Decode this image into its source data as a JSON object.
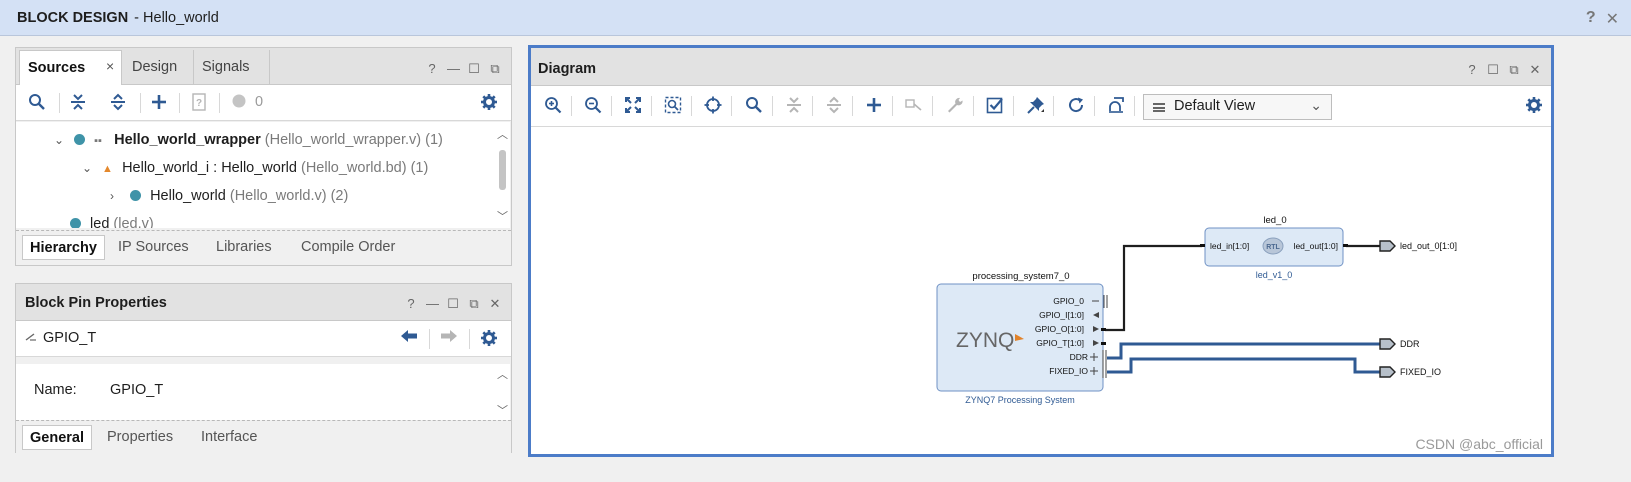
{
  "window": {
    "title_bold": "BLOCK DESIGN",
    "title_rest": "- Hello_world",
    "help": "?",
    "close": "✕"
  },
  "sources": {
    "tabs": [
      {
        "label": "Sources"
      },
      {
        "label": "Design"
      },
      {
        "label": "Signals"
      }
    ],
    "close_glyph": "×",
    "header_icons": {
      "help": "?",
      "minimize": "—",
      "maximize": "☐",
      "float": "⧉"
    },
    "toolbar": {
      "status_count": "0"
    },
    "tree": [
      {
        "label": "Hello_world_wrapper",
        "detail": "(Hello_world_wrapper.v) (1)"
      },
      {
        "label": "Hello_world_i : Hello_world",
        "detail": "(Hello_world.bd) (1)"
      },
      {
        "label": "Hello_world",
        "detail": "(Hello_world.v) (2)"
      },
      {
        "label": "led",
        "detail": "(led.v)"
      }
    ],
    "bottom_tabs": [
      {
        "label": "Hierarchy"
      },
      {
        "label": "IP Sources"
      },
      {
        "label": "Libraries"
      },
      {
        "label": "Compile Order"
      }
    ]
  },
  "pin_properties": {
    "title": "Block Pin Properties",
    "header_icons": {
      "help": "?",
      "minimize": "—",
      "maximize": "☐",
      "float": "⧉",
      "close": "✕"
    },
    "pin": "GPIO_T",
    "name_label": "Name:",
    "name_value": "GPIO_T",
    "bottom_tabs": [
      {
        "label": "General"
      },
      {
        "label": "Properties"
      },
      {
        "label": "Interface"
      }
    ]
  },
  "diagram": {
    "title": "Diagram",
    "header_icons": {
      "help": "?",
      "maximize": "☐",
      "float": "⧉",
      "close": "✕"
    },
    "view": "Default View",
    "ps_block": {
      "title": "processing_system7_0",
      "logo": "ZYNQ",
      "subtitle": "ZYNQ7 Processing System",
      "ports": [
        "GPIO_0",
        "GPIO_I[1:0]",
        "GPIO_O[1:0]",
        "GPIO_T[1:0]",
        "DDR",
        "FIXED_IO"
      ]
    },
    "led_block": {
      "title": "led_0",
      "in_port": "led_in[1:0]",
      "out_port": "led_out[1:0]",
      "badge": "RTL",
      "subtitle": "led_v1_0"
    },
    "external_ports": [
      "led_out_0[1:0]",
      "DDR",
      "FIXED_IO"
    ]
  },
  "watermark": "CSDN @abc_official"
}
